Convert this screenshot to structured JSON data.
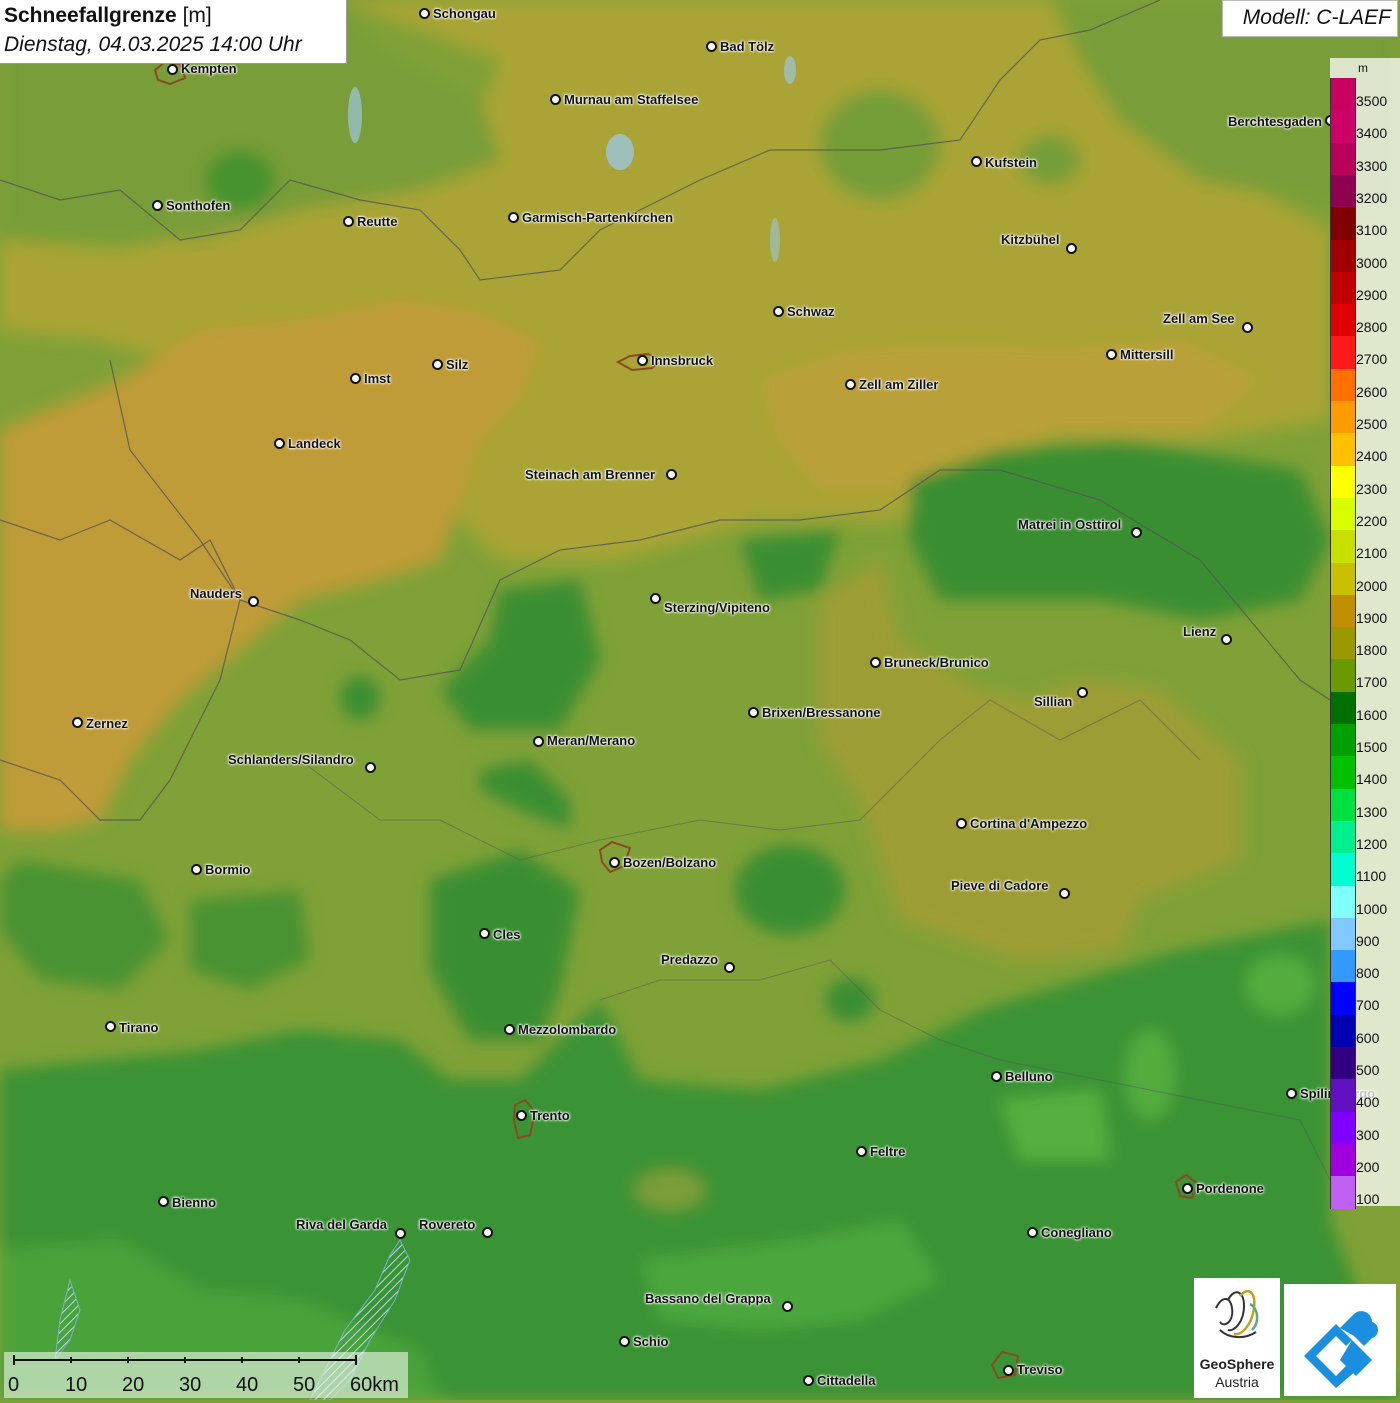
{
  "header": {
    "title": "Schneefallgrenze",
    "unit": "[m]",
    "date": "Dienstag, 04.03.2025 14:00 Uhr",
    "model": "Modell: C-LAEF"
  },
  "legend": {
    "unit": "m",
    "entries": [
      {
        "label": "3500",
        "color": "#c8005f"
      },
      {
        "label": "3400",
        "color": "#cc0066"
      },
      {
        "label": "3300",
        "color": "#b8005a"
      },
      {
        "label": "3200",
        "color": "#900050"
      },
      {
        "label": "3100",
        "color": "#800000"
      },
      {
        "label": "3000",
        "color": "#a00000"
      },
      {
        "label": "2900",
        "color": "#c00000"
      },
      {
        "label": "2800",
        "color": "#e00000"
      },
      {
        "label": "2700",
        "color": "#ff1a1a"
      },
      {
        "label": "2600",
        "color": "#ff7000"
      },
      {
        "label": "2500",
        "color": "#ff9a00"
      },
      {
        "label": "2400",
        "color": "#ffc000"
      },
      {
        "label": "2300",
        "color": "#ffff00"
      },
      {
        "label": "2200",
        "color": "#d8ff00"
      },
      {
        "label": "2100",
        "color": "#c8e000"
      },
      {
        "label": "2000",
        "color": "#c8c000"
      },
      {
        "label": "1900",
        "color": "#c09000"
      },
      {
        "label": "1800",
        "color": "#9a9a00"
      },
      {
        "label": "1700",
        "color": "#6a9a00"
      },
      {
        "label": "1600",
        "color": "#007000"
      },
      {
        "label": "1500",
        "color": "#00a000"
      },
      {
        "label": "1400",
        "color": "#00c000"
      },
      {
        "label": "1300",
        "color": "#00e040"
      },
      {
        "label": "1200",
        "color": "#00f090"
      },
      {
        "label": "1100",
        "color": "#00ffd0"
      },
      {
        "label": "1000",
        "color": "#80ffff"
      },
      {
        "label": "900",
        "color": "#80c8ff"
      },
      {
        "label": "800",
        "color": "#3399ff"
      },
      {
        "label": "700",
        "color": "#0000ff"
      },
      {
        "label": "600",
        "color": "#0000b0"
      },
      {
        "label": "500",
        "color": "#300080"
      },
      {
        "label": "400",
        "color": "#6010c0"
      },
      {
        "label": "300",
        "color": "#8000ff"
      },
      {
        "label": "200",
        "color": "#a000e0"
      },
      {
        "label": "100",
        "color": "#c060f0"
      }
    ]
  },
  "cities": [
    {
      "name": "Schongau",
      "dot": [
        424,
        13
      ],
      "label": [
        433,
        7
      ],
      "align": "left"
    },
    {
      "name": "Bad Tölz",
      "dot": [
        711,
        46
      ],
      "label": [
        720,
        40
      ],
      "align": "left"
    },
    {
      "name": "Kempten",
      "dot": [
        172,
        69
      ],
      "label": [
        181,
        62
      ],
      "align": "left"
    },
    {
      "name": "Murnau am Staffelsee",
      "dot": [
        555,
        99
      ],
      "label": [
        564,
        93
      ],
      "align": "left"
    },
    {
      "name": "Kufstein",
      "dot": [
        976,
        161
      ],
      "label": [
        985,
        156
      ],
      "align": "left"
    },
    {
      "name": "Berchtesgaden",
      "dot": [
        1330,
        120
      ],
      "label": [
        1228,
        115
      ],
      "align": "left"
    },
    {
      "name": "Sonthofen",
      "dot": [
        157,
        205
      ],
      "label": [
        166,
        199
      ],
      "align": "left"
    },
    {
      "name": "Reutte",
      "dot": [
        348,
        221
      ],
      "label": [
        357,
        215
      ],
      "align": "left"
    },
    {
      "name": "Garmisch-Partenkirchen",
      "dot": [
        513,
        217
      ],
      "label": [
        522,
        211
      ],
      "align": "left"
    },
    {
      "name": "Kitzbühel",
      "dot": [
        1071,
        248
      ],
      "label": [
        1001,
        233
      ],
      "align": "left"
    },
    {
      "name": "Schwaz",
      "dot": [
        778,
        311
      ],
      "label": [
        787,
        305
      ],
      "align": "left"
    },
    {
      "name": "Zell am See",
      "dot": [
        1247,
        327
      ],
      "label": [
        1163,
        312
      ],
      "align": "left"
    },
    {
      "name": "Mittersill",
      "dot": [
        1111,
        354
      ],
      "label": [
        1120,
        348
      ],
      "align": "left"
    },
    {
      "name": "Innsbruck",
      "dot": [
        642,
        360
      ],
      "label": [
        651,
        354
      ],
      "align": "left"
    },
    {
      "name": "Silz",
      "dot": [
        437,
        364
      ],
      "label": [
        446,
        358
      ],
      "align": "left"
    },
    {
      "name": "Imst",
      "dot": [
        355,
        378
      ],
      "label": [
        364,
        372
      ],
      "align": "left"
    },
    {
      "name": "Zell am Ziller",
      "dot": [
        850,
        384
      ],
      "label": [
        859,
        378
      ],
      "align": "left"
    },
    {
      "name": "Landeck",
      "dot": [
        279,
        443
      ],
      "label": [
        288,
        437
      ],
      "align": "left"
    },
    {
      "name": "Steinach am Brenner",
      "dot": [
        671,
        474
      ],
      "label": [
        525,
        468
      ],
      "align": "left"
    },
    {
      "name": "Matrei in Osttirol",
      "dot": [
        1136,
        532
      ],
      "label": [
        1018,
        518
      ],
      "align": "left"
    },
    {
      "name": "Nauders",
      "dot": [
        253,
        601
      ],
      "label": [
        190,
        587
      ],
      "align": "left"
    },
    {
      "name": "Sterzing/Vipiteno",
      "dot": [
        655,
        598
      ],
      "label": [
        664,
        601
      ],
      "align": "left"
    },
    {
      "name": "Lienz",
      "dot": [
        1226,
        639
      ],
      "label": [
        1183,
        625
      ],
      "align": "left"
    },
    {
      "name": "Bruneck/Brunico",
      "dot": [
        875,
        662
      ],
      "label": [
        884,
        656
      ],
      "align": "left"
    },
    {
      "name": "Sillian",
      "dot": [
        1082,
        692
      ],
      "label": [
        1034,
        695
      ],
      "align": "left"
    },
    {
      "name": "Brixen/Bressanone",
      "dot": [
        753,
        712
      ],
      "label": [
        762,
        706
      ],
      "align": "left"
    },
    {
      "name": "Zernez",
      "dot": [
        77,
        722
      ],
      "label": [
        86,
        717
      ],
      "align": "left"
    },
    {
      "name": "Meran/Merano",
      "dot": [
        538,
        741
      ],
      "label": [
        547,
        734
      ],
      "align": "left"
    },
    {
      "name": "Schlanders/Silandro",
      "dot": [
        370,
        767
      ],
      "label": [
        228,
        753
      ],
      "align": "left"
    },
    {
      "name": "Cortina d'Ampezzo",
      "dot": [
        961,
        823
      ],
      "label": [
        970,
        817
      ],
      "align": "left"
    },
    {
      "name": "Bozen/Bolzano",
      "dot": [
        614,
        862
      ],
      "label": [
        623,
        856
      ],
      "align": "left"
    },
    {
      "name": "Bormio",
      "dot": [
        196,
        869
      ],
      "label": [
        205,
        863
      ],
      "align": "left"
    },
    {
      "name": "Pieve di Cadore",
      "dot": [
        1064,
        893
      ],
      "label": [
        951,
        879
      ],
      "align": "left"
    },
    {
      "name": "Cles",
      "dot": [
        484,
        933
      ],
      "label": [
        493,
        928
      ],
      "align": "left"
    },
    {
      "name": "Predazzo",
      "dot": [
        729,
        967
      ],
      "label": [
        661,
        953
      ],
      "align": "left"
    },
    {
      "name": "Tirano",
      "dot": [
        110,
        1026
      ],
      "label": [
        119,
        1021
      ],
      "align": "left"
    },
    {
      "name": "Mezzolombardo",
      "dot": [
        509,
        1029
      ],
      "label": [
        518,
        1023
      ],
      "align": "left"
    },
    {
      "name": "Belluno",
      "dot": [
        996,
        1076
      ],
      "label": [
        1005,
        1070
      ],
      "align": "left"
    },
    {
      "name": "Spilimbergo",
      "dot": [
        1291,
        1093
      ],
      "label": [
        1300,
        1087
      ],
      "align": "left"
    },
    {
      "name": "Trento",
      "dot": [
        521,
        1115
      ],
      "label": [
        530,
        1109
      ],
      "align": "left"
    },
    {
      "name": "Feltre",
      "dot": [
        861,
        1151
      ],
      "label": [
        870,
        1145
      ],
      "align": "left"
    },
    {
      "name": "Pordenone",
      "dot": [
        1187,
        1188
      ],
      "label": [
        1196,
        1182
      ],
      "align": "left"
    },
    {
      "name": "Bienno",
      "dot": [
        163,
        1201
      ],
      "label": [
        172,
        1196
      ],
      "align": "left"
    },
    {
      "name": "Riva del Garda",
      "dot": [
        400,
        1233
      ],
      "label": [
        296,
        1218
      ],
      "align": "left"
    },
    {
      "name": "Rovereto",
      "dot": [
        487,
        1232
      ],
      "label": [
        419,
        1218
      ],
      "align": "left"
    },
    {
      "name": "Conegliano",
      "dot": [
        1032,
        1232
      ],
      "label": [
        1041,
        1226
      ],
      "align": "left"
    },
    {
      "name": "Bassano del Grappa",
      "dot": [
        787,
        1306
      ],
      "label": [
        645,
        1292
      ],
      "align": "left"
    },
    {
      "name": "Schio",
      "dot": [
        624,
        1341
      ],
      "label": [
        633,
        1335
      ],
      "align": "left"
    },
    {
      "name": "Treviso",
      "dot": [
        1008,
        1370
      ],
      "label": [
        1017,
        1363
      ],
      "align": "left"
    },
    {
      "name": "Cittadella",
      "dot": [
        808,
        1380
      ],
      "label": [
        817,
        1374
      ],
      "align": "left"
    }
  ],
  "scale_bar": {
    "labels": [
      "0",
      "10",
      "20",
      "30",
      "40",
      "50",
      "60km"
    ]
  },
  "logos": {
    "geosphere_name": "GeoSphere",
    "geosphere_sub": "Austria"
  }
}
